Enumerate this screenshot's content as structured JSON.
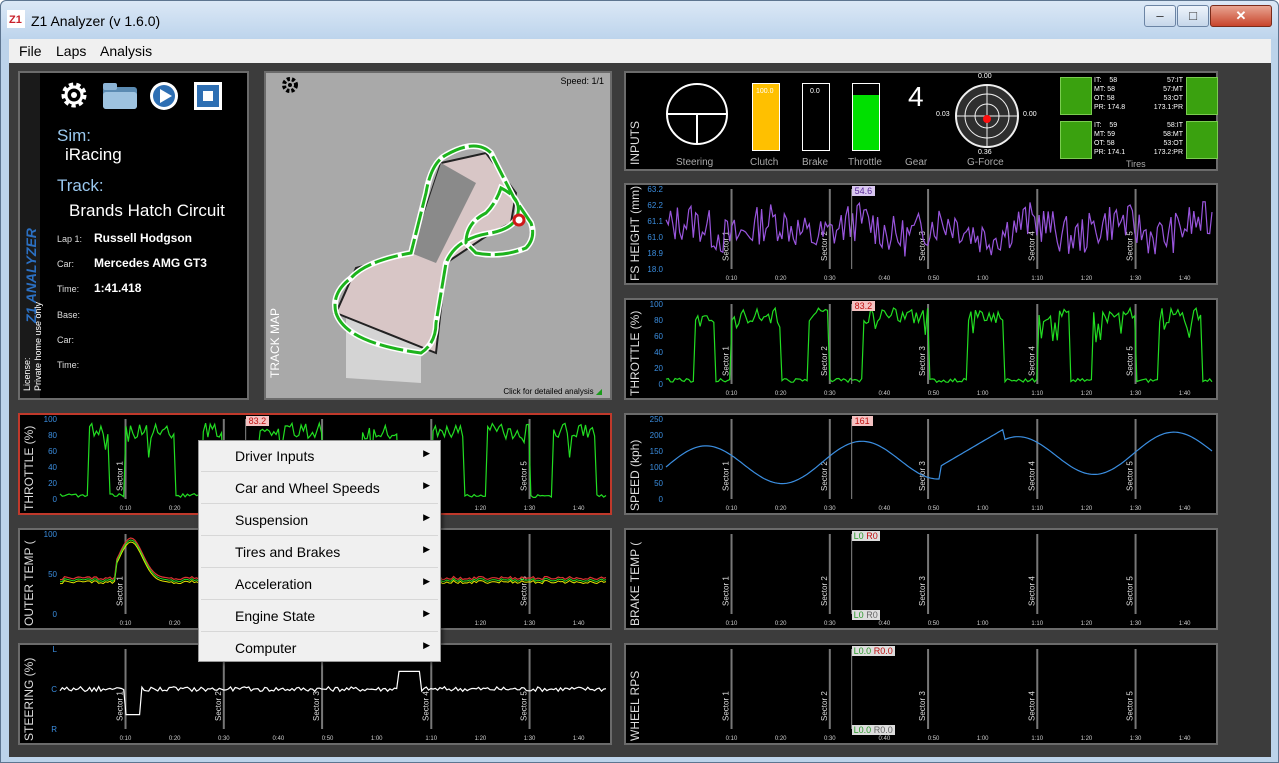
{
  "window": {
    "title": "Z1 Analyzer (v 1.6.0)",
    "minimize": "–",
    "maximize": "□",
    "close": "✕"
  },
  "menu": [
    "File",
    "Laps",
    "Analysis"
  ],
  "info": {
    "brand": "Z1 ANALYZER",
    "sim_label": "Sim:",
    "sim_value": "iRacing",
    "track_label": "Track:",
    "track_value": "Brands Hatch Circuit",
    "lap_label": "Lap 1:",
    "lap_value": "Russell Hodgson",
    "car_label": "Car:",
    "car_value": "Mercedes AMG GT3",
    "time_label": "Time:",
    "time_value": "1:41.418",
    "base_label": "Base:",
    "car2_label": "Car:",
    "time2_label": "Time:",
    "license": "License:",
    "license_text": "Private home use only"
  },
  "track_map": {
    "label": "TRACK MAP",
    "speed": "Speed: 1/1",
    "hint": "Click for detailed analysis"
  },
  "inputs": {
    "label": "INPUTS",
    "steering": "Steering",
    "clutch": "Clutch",
    "brake": "Brake",
    "throttle": "Throttle",
    "gear_label": "Gear",
    "gforce": "G-Force",
    "tires": "Tires",
    "clutch_value": "100.0",
    "brake_value": "0.0",
    "throttle_value": "83.2",
    "gear_value": "4",
    "g_top": "0.00",
    "g_left": "0.03",
    "g_right": "0.00",
    "g_bottom": "0.36",
    "tire_fl": [
      "IT:",
      "58",
      "MT:",
      "58",
      "OT:",
      "58",
      "PR:",
      "174.8"
    ],
    "tire_fr": [
      "57",
      ":IT",
      "57",
      ":MT",
      "53",
      ":OT",
      "173.1",
      ":PR"
    ],
    "tire_rl": [
      "IT:",
      "59",
      "MT:",
      "59",
      "OT:",
      "58",
      "PR:",
      "174.1"
    ],
    "tire_rr": [
      "58",
      ":IT",
      "58",
      ":MT",
      "53",
      ":OT",
      "173.2",
      ":PR"
    ]
  },
  "chart_data": [
    {
      "type": "line",
      "title": "FS HEIGHT (mm)",
      "ylim": [
        18.0,
        63.2
      ],
      "yticks": [
        "63.2",
        "62.2",
        "61.1",
        "61.0",
        "18.9",
        "18.0"
      ],
      "cursor": "54.6"
    },
    {
      "type": "line",
      "title": "THROTTLE (%)",
      "ylim": [
        0,
        100
      ],
      "yticks": [
        "100",
        "80",
        "60",
        "40",
        "20",
        "0"
      ],
      "cursor": "83.2"
    },
    {
      "type": "line",
      "title": "THROTTLE (%)",
      "ylim": [
        0,
        100
      ],
      "yticks": [
        "100",
        "80",
        "60",
        "40",
        "20",
        "0"
      ],
      "cursor": "83.2"
    },
    {
      "type": "line",
      "title": "SPEED (kph)",
      "ylim": [
        0,
        250
      ],
      "yticks": [
        "250",
        "200",
        "150",
        "100",
        "50",
        "0"
      ],
      "cursor": "161"
    },
    {
      "type": "line",
      "title": "OUTER TEMP (",
      "ylim": [
        0,
        100
      ],
      "yticks": [
        "100",
        "50",
        "0"
      ]
    },
    {
      "type": "line",
      "title": "BRAKE TEMP (",
      "yticks": [],
      "badges": [
        "L0",
        "R0",
        "L0",
        "R0"
      ]
    },
    {
      "type": "line",
      "title": "STEERING (%)",
      "yticks": [
        "L",
        "C",
        "R"
      ]
    },
    {
      "type": "line",
      "title": "WHEEL RPS",
      "yticks": [],
      "badges": [
        "L0.0",
        "R0.0",
        "L0.0",
        "R0.0"
      ]
    }
  ],
  "sectors": [
    "Sector 1",
    "Sector 2",
    "Sector 3",
    "Sector 4",
    "Sector 5"
  ],
  "xticks": [
    "0:10",
    "0:20",
    "0:30",
    "0:40",
    "0:50",
    "1:00",
    "1:10",
    "1:20",
    "1:30",
    "1:40"
  ],
  "context_menu": [
    "Driver Inputs",
    "Car and Wheel Speeds",
    "Suspension",
    "Tires and Brakes",
    "Acceleration",
    "Engine State",
    "Computer"
  ]
}
